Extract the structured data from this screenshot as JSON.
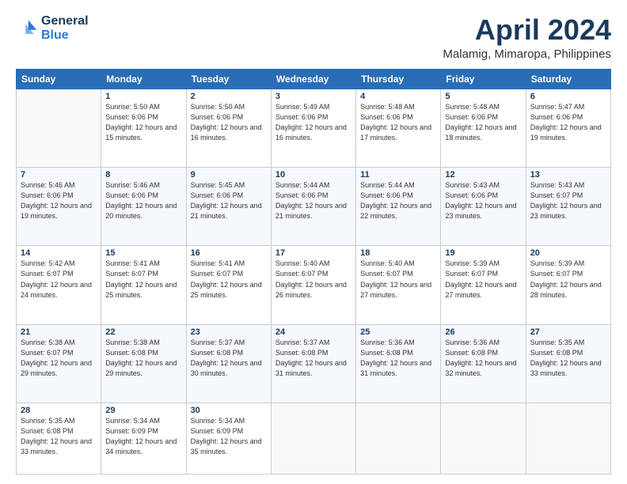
{
  "header": {
    "logo_line1": "General",
    "logo_line2": "Blue",
    "month": "April 2024",
    "location": "Malamig, Mimaropa, Philippines"
  },
  "days_of_week": [
    "Sunday",
    "Monday",
    "Tuesday",
    "Wednesday",
    "Thursday",
    "Friday",
    "Saturday"
  ],
  "weeks": [
    [
      {
        "day": "",
        "sunrise": "",
        "sunset": "",
        "daylight": ""
      },
      {
        "day": "1",
        "sunrise": "Sunrise: 5:50 AM",
        "sunset": "Sunset: 6:06 PM",
        "daylight": "Daylight: 12 hours and 15 minutes."
      },
      {
        "day": "2",
        "sunrise": "Sunrise: 5:50 AM",
        "sunset": "Sunset: 6:06 PM",
        "daylight": "Daylight: 12 hours and 16 minutes."
      },
      {
        "day": "3",
        "sunrise": "Sunrise: 5:49 AM",
        "sunset": "Sunset: 6:06 PM",
        "daylight": "Daylight: 12 hours and 16 minutes."
      },
      {
        "day": "4",
        "sunrise": "Sunrise: 5:48 AM",
        "sunset": "Sunset: 6:06 PM",
        "daylight": "Daylight: 12 hours and 17 minutes."
      },
      {
        "day": "5",
        "sunrise": "Sunrise: 5:48 AM",
        "sunset": "Sunset: 6:06 PM",
        "daylight": "Daylight: 12 hours and 18 minutes."
      },
      {
        "day": "6",
        "sunrise": "Sunrise: 5:47 AM",
        "sunset": "Sunset: 6:06 PM",
        "daylight": "Daylight: 12 hours and 19 minutes."
      }
    ],
    [
      {
        "day": "7",
        "sunrise": "Sunrise: 5:46 AM",
        "sunset": "Sunset: 6:06 PM",
        "daylight": "Daylight: 12 hours and 19 minutes."
      },
      {
        "day": "8",
        "sunrise": "Sunrise: 5:46 AM",
        "sunset": "Sunset: 6:06 PM",
        "daylight": "Daylight: 12 hours and 20 minutes."
      },
      {
        "day": "9",
        "sunrise": "Sunrise: 5:45 AM",
        "sunset": "Sunset: 6:06 PM",
        "daylight": "Daylight: 12 hours and 21 minutes."
      },
      {
        "day": "10",
        "sunrise": "Sunrise: 5:44 AM",
        "sunset": "Sunset: 6:06 PM",
        "daylight": "Daylight: 12 hours and 21 minutes."
      },
      {
        "day": "11",
        "sunrise": "Sunrise: 5:44 AM",
        "sunset": "Sunset: 6:06 PM",
        "daylight": "Daylight: 12 hours and 22 minutes."
      },
      {
        "day": "12",
        "sunrise": "Sunrise: 5:43 AM",
        "sunset": "Sunset: 6:06 PM",
        "daylight": "Daylight: 12 hours and 23 minutes."
      },
      {
        "day": "13",
        "sunrise": "Sunrise: 5:43 AM",
        "sunset": "Sunset: 6:07 PM",
        "daylight": "Daylight: 12 hours and 23 minutes."
      }
    ],
    [
      {
        "day": "14",
        "sunrise": "Sunrise: 5:42 AM",
        "sunset": "Sunset: 6:07 PM",
        "daylight": "Daylight: 12 hours and 24 minutes."
      },
      {
        "day": "15",
        "sunrise": "Sunrise: 5:41 AM",
        "sunset": "Sunset: 6:07 PM",
        "daylight": "Daylight: 12 hours and 25 minutes."
      },
      {
        "day": "16",
        "sunrise": "Sunrise: 5:41 AM",
        "sunset": "Sunset: 6:07 PM",
        "daylight": "Daylight: 12 hours and 25 minutes."
      },
      {
        "day": "17",
        "sunrise": "Sunrise: 5:40 AM",
        "sunset": "Sunset: 6:07 PM",
        "daylight": "Daylight: 12 hours and 26 minutes."
      },
      {
        "day": "18",
        "sunrise": "Sunrise: 5:40 AM",
        "sunset": "Sunset: 6:07 PM",
        "daylight": "Daylight: 12 hours and 27 minutes."
      },
      {
        "day": "19",
        "sunrise": "Sunrise: 5:39 AM",
        "sunset": "Sunset: 6:07 PM",
        "daylight": "Daylight: 12 hours and 27 minutes."
      },
      {
        "day": "20",
        "sunrise": "Sunrise: 5:39 AM",
        "sunset": "Sunset: 6:07 PM",
        "daylight": "Daylight: 12 hours and 28 minutes."
      }
    ],
    [
      {
        "day": "21",
        "sunrise": "Sunrise: 5:38 AM",
        "sunset": "Sunset: 6:07 PM",
        "daylight": "Daylight: 12 hours and 29 minutes."
      },
      {
        "day": "22",
        "sunrise": "Sunrise: 5:38 AM",
        "sunset": "Sunset: 6:08 PM",
        "daylight": "Daylight: 12 hours and 29 minutes."
      },
      {
        "day": "23",
        "sunrise": "Sunrise: 5:37 AM",
        "sunset": "Sunset: 6:08 PM",
        "daylight": "Daylight: 12 hours and 30 minutes."
      },
      {
        "day": "24",
        "sunrise": "Sunrise: 5:37 AM",
        "sunset": "Sunset: 6:08 PM",
        "daylight": "Daylight: 12 hours and 31 minutes."
      },
      {
        "day": "25",
        "sunrise": "Sunrise: 5:36 AM",
        "sunset": "Sunset: 6:08 PM",
        "daylight": "Daylight: 12 hours and 31 minutes."
      },
      {
        "day": "26",
        "sunrise": "Sunrise: 5:36 AM",
        "sunset": "Sunset: 6:08 PM",
        "daylight": "Daylight: 12 hours and 32 minutes."
      },
      {
        "day": "27",
        "sunrise": "Sunrise: 5:35 AM",
        "sunset": "Sunset: 6:08 PM",
        "daylight": "Daylight: 12 hours and 33 minutes."
      }
    ],
    [
      {
        "day": "28",
        "sunrise": "Sunrise: 5:35 AM",
        "sunset": "Sunset: 6:08 PM",
        "daylight": "Daylight: 12 hours and 33 minutes."
      },
      {
        "day": "29",
        "sunrise": "Sunrise: 5:34 AM",
        "sunset": "Sunset: 6:09 PM",
        "daylight": "Daylight: 12 hours and 34 minutes."
      },
      {
        "day": "30",
        "sunrise": "Sunrise: 5:34 AM",
        "sunset": "Sunset: 6:09 PM",
        "daylight": "Daylight: 12 hours and 35 minutes."
      },
      {
        "day": "",
        "sunrise": "",
        "sunset": "",
        "daylight": ""
      },
      {
        "day": "",
        "sunrise": "",
        "sunset": "",
        "daylight": ""
      },
      {
        "day": "",
        "sunrise": "",
        "sunset": "",
        "daylight": ""
      },
      {
        "day": "",
        "sunrise": "",
        "sunset": "",
        "daylight": ""
      }
    ]
  ]
}
